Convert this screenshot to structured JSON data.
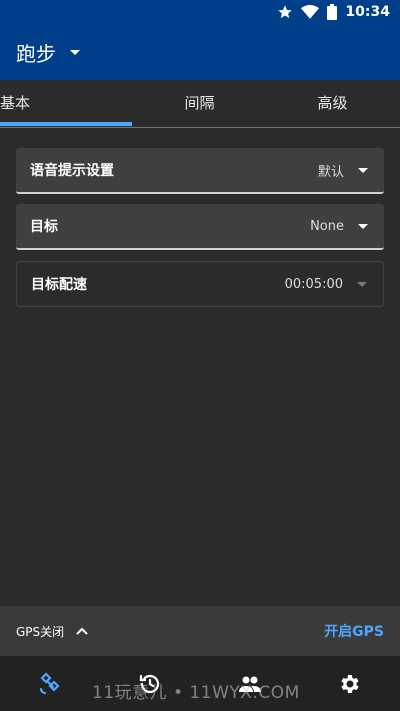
{
  "status_bar": {
    "time": "10:34",
    "icons": [
      "star-icon",
      "wifi-icon",
      "battery-icon"
    ]
  },
  "app_bar": {
    "title": "跑步"
  },
  "tabs": [
    {
      "label": "基本",
      "selected": true
    },
    {
      "label": "间隔",
      "selected": false
    },
    {
      "label": "高级",
      "selected": false
    }
  ],
  "settings": {
    "voice_prompt": {
      "label": "语音提示设置",
      "value": "默认"
    },
    "goal": {
      "label": "目标",
      "value": "None"
    },
    "target_pace": {
      "label": "目标配速",
      "value": "00:05:00"
    }
  },
  "gps": {
    "status": "GPS关闭",
    "action": "开启GPS"
  },
  "bottom_nav": [
    {
      "icon": "satellite-icon",
      "active": true
    },
    {
      "icon": "history-icon",
      "active": false
    },
    {
      "icon": "people-icon",
      "active": false
    },
    {
      "icon": "gear-icon",
      "active": false
    }
  ],
  "watermark": "11玩意儿 • 11WYX.COM",
  "colors": {
    "primary": "#003f8a",
    "accent": "#4da6ff",
    "background": "#2b2b2b"
  }
}
